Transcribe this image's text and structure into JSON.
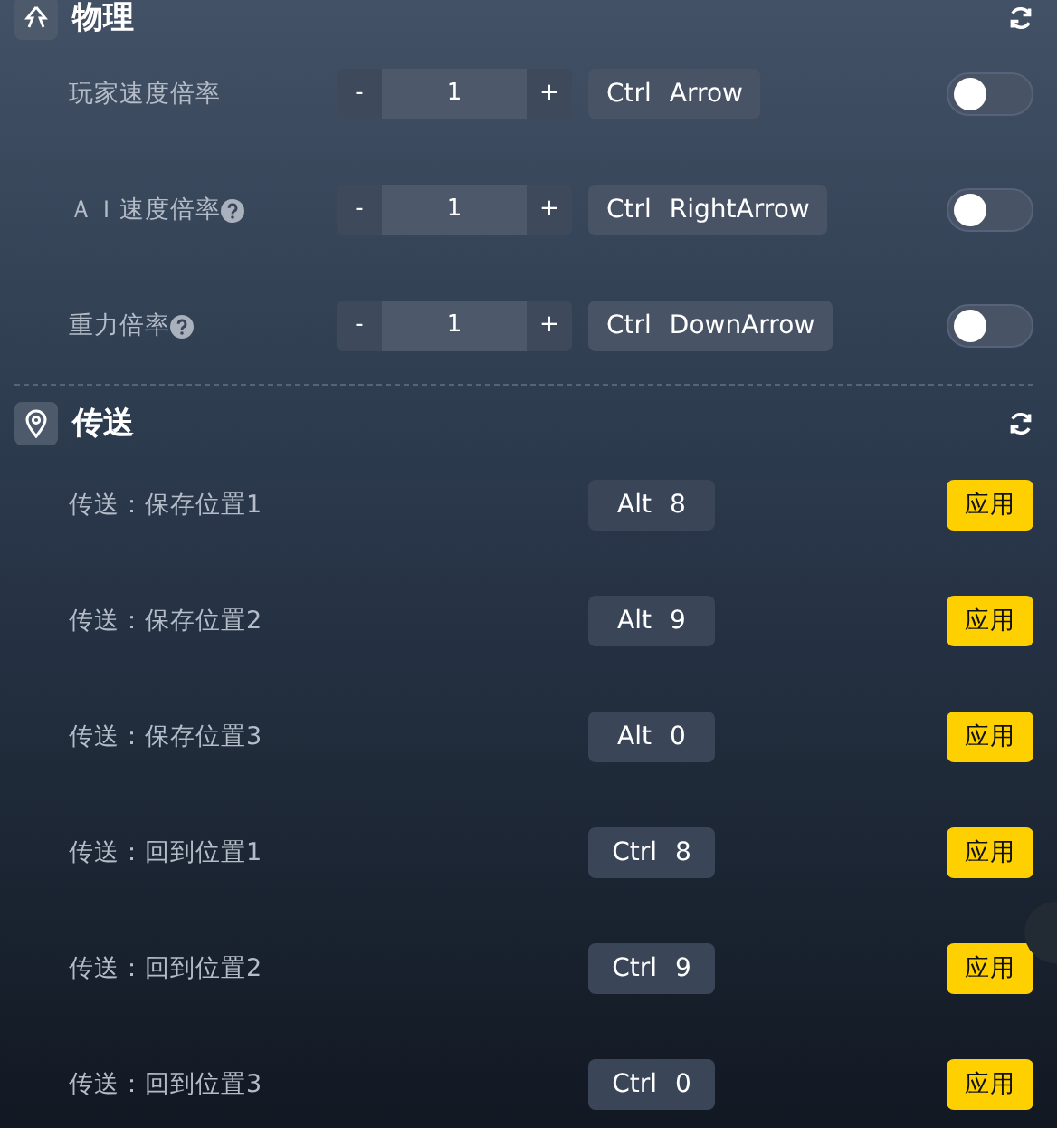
{
  "sections": [
    {
      "title": "物理",
      "rows": [
        {
          "kind": "stepper",
          "label": "玩家速度倍率",
          "help": false,
          "minus": "-",
          "value": "1",
          "plus": "+",
          "keys": [
            "Ctrl",
            "Arrow"
          ],
          "on": false
        },
        {
          "kind": "stepper",
          "label": "ＡＩ速度倍率",
          "help": true,
          "minus": "-",
          "value": "1",
          "plus": "+",
          "keys": [
            "Ctrl",
            "RightArrow"
          ],
          "on": false
        },
        {
          "kind": "stepper",
          "label": "重力倍率",
          "help": true,
          "minus": "-",
          "value": "1",
          "plus": "+",
          "keys": [
            "Ctrl",
            "DownArrow"
          ],
          "on": false
        }
      ]
    },
    {
      "title": "传送",
      "rows": [
        {
          "kind": "apply",
          "label": "传送：保存位置1",
          "keys": [
            "Alt",
            "8"
          ],
          "button": "应用"
        },
        {
          "kind": "apply",
          "label": "传送：保存位置2",
          "keys": [
            "Alt",
            "9"
          ],
          "button": "应用"
        },
        {
          "kind": "apply",
          "label": "传送：保存位置3",
          "keys": [
            "Alt",
            "0"
          ],
          "button": "应用"
        },
        {
          "kind": "apply",
          "label": "传送：回到位置1",
          "keys": [
            "Ctrl",
            "8"
          ],
          "button": "应用"
        },
        {
          "kind": "apply",
          "label": "传送：回到位置2",
          "keys": [
            "Ctrl",
            "9"
          ],
          "button": "应用"
        },
        {
          "kind": "apply",
          "label": "传送：回到位置3",
          "keys": [
            "Ctrl",
            "0"
          ],
          "button": "应用"
        }
      ]
    }
  ]
}
